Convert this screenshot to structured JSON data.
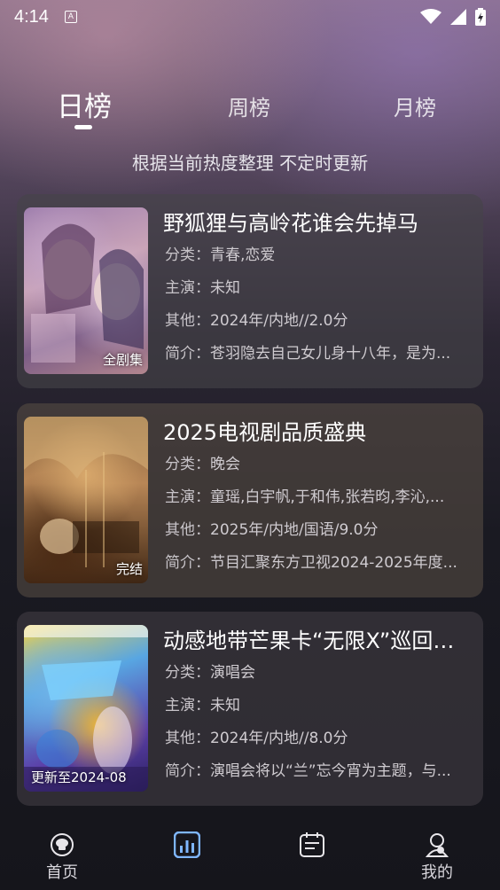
{
  "status_bar": {
    "time": "4:14",
    "indicator_icon": "a-notification-icon",
    "wifi_icon": "wifi-icon",
    "signal_icon": "signal-icon",
    "battery_icon": "battery-charging-icon"
  },
  "tabs": [
    {
      "label": "日榜",
      "active": true
    },
    {
      "label": "周榜",
      "active": false
    },
    {
      "label": "月榜",
      "active": false
    }
  ],
  "subtitle": "根据当前热度整理 不定时更新",
  "cards": [
    {
      "title": "野狐狸与高岭花谁会先掉马",
      "badge": "全剧集",
      "category_key": "分类：",
      "category": "青春,恋爱",
      "cast_key": "主演：",
      "cast": "未知",
      "other_key": "其他：",
      "other": "2024年/内地//2.0分",
      "intro_key": "简介：",
      "intro": "苍羽隐去自己女儿身十八年，是为..."
    },
    {
      "title": "2025电视剧品质盛典",
      "badge": "完结",
      "category_key": "分类：",
      "category": "晚会",
      "cast_key": "主演：",
      "cast": "童瑶,白宇帆,于和伟,张若昀,李沁,...",
      "other_key": "其他：",
      "other": "2025年/内地/国语/9.0分",
      "intro_key": "简介：",
      "intro": "节目汇聚东方卫视2024-2025年度..."
    },
    {
      "title": "动感地带芒果卡“无限X”巡回演...",
      "badge": "更新至2024-08",
      "category_key": "分类：",
      "category": "演唱会",
      "cast_key": "主演：",
      "cast": "未知",
      "other_key": "其他：",
      "other": "2024年/内地//8.0分",
      "intro_key": "简介：",
      "intro": "演唱会将以“兰”忘今宵为主题，与..."
    }
  ],
  "bottom_nav": [
    {
      "label": "首页",
      "icon": "home-icon"
    },
    {
      "label": "",
      "icon": "ranking-chart-icon",
      "active": true
    },
    {
      "label": "",
      "icon": "schedule-calendar-icon"
    },
    {
      "label": "我的",
      "icon": "profile-icon"
    }
  ],
  "colors": {
    "accent_blue": "#7fb6ff",
    "card_bg": "#46444a"
  }
}
